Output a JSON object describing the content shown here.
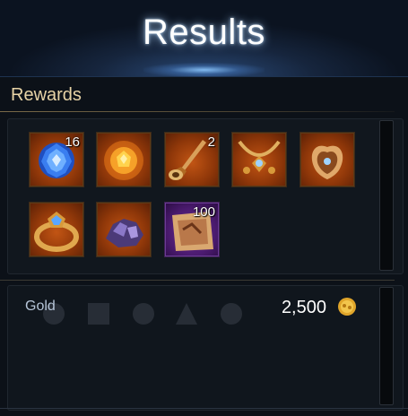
{
  "header": {
    "title": "Results"
  },
  "rewards": {
    "label": "Rewards",
    "items": [
      {
        "icon": "blue-gem-icon",
        "quantity": "16",
        "rarity": "orange"
      },
      {
        "icon": "fire-orb-icon",
        "quantity": "",
        "rarity": "orange"
      },
      {
        "icon": "horn-icon",
        "quantity": "2",
        "rarity": "orange"
      },
      {
        "icon": "necklace-icon",
        "quantity": "",
        "rarity": "orange"
      },
      {
        "icon": "earrings-icon",
        "quantity": "",
        "rarity": "orange"
      },
      {
        "icon": "ring-icon",
        "quantity": "",
        "rarity": "orange"
      },
      {
        "icon": "crystal-ore-icon",
        "quantity": "",
        "rarity": "orange"
      },
      {
        "icon": "map-scroll-icon",
        "quantity": "100",
        "rarity": "purple"
      }
    ]
  },
  "gold": {
    "label": "Gold",
    "value": "2,500",
    "icon": "gold-coin-icon"
  },
  "colors": {
    "title_glow": "#aad2ff",
    "label_gold": "#e7d3a6",
    "orange_slot": "#c25514",
    "purple_slot": "#6a2e96"
  }
}
